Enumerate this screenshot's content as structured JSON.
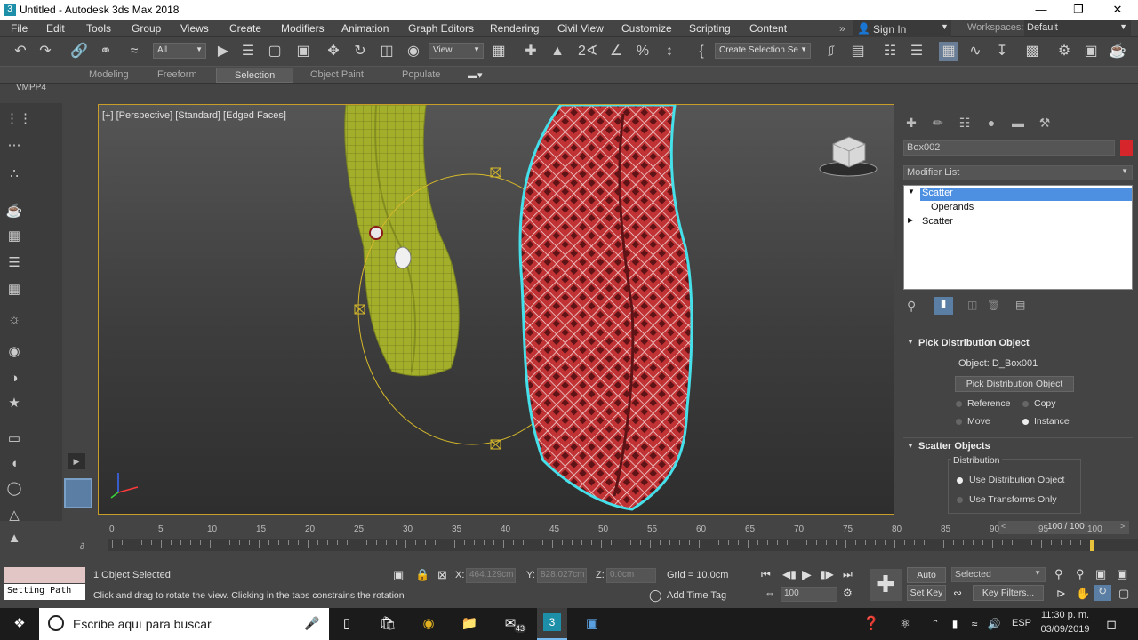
{
  "window": {
    "title": "Untitled - Autodesk 3ds Max 2018",
    "app_icon": "3"
  },
  "menu": [
    "File",
    "Edit",
    "Tools",
    "Group",
    "Views",
    "Create",
    "Modifiers",
    "Animation",
    "Graph Editors",
    "Rendering",
    "Civil View",
    "Customize",
    "Scripting",
    "Content"
  ],
  "signin": {
    "label": "Sign In",
    "workspaces_label": "Workspaces:",
    "workspace": "Default"
  },
  "toolbar": {
    "filter": "All",
    "view": "View",
    "selection_set": "Create Selection Se"
  },
  "ribbon": {
    "tabs": [
      "Modeling",
      "Freeform",
      "Selection",
      "Object Paint",
      "Populate"
    ],
    "active": "Selection"
  },
  "ribbon_sub": {
    "label": "VMPP4"
  },
  "viewport": {
    "label": "[+] [Perspective] [Standard] [Edged Faces]"
  },
  "cmd": {
    "object_name": "Box002",
    "modifier_list": "Modifier List",
    "stack": [
      "Scatter",
      "Operands",
      "Scatter"
    ],
    "pick": {
      "title": "Pick Distribution Object",
      "object_label": "Object: D_Box001",
      "button": "Pick Distribution Object",
      "opt_reference": "Reference",
      "opt_copy": "Copy",
      "opt_move": "Move",
      "opt_instance": "Instance"
    },
    "scatter": {
      "title": "Scatter Objects",
      "group": "Distribution",
      "opt_use_dist": "Use Distribution Object",
      "opt_use_trans": "Use Transforms Only"
    }
  },
  "timeline": {
    "frame_display": "100 / 100",
    "ticks": [
      "0",
      "5",
      "10",
      "15",
      "20",
      "25",
      "30",
      "35",
      "40",
      "45",
      "50",
      "55",
      "60",
      "65",
      "70",
      "75",
      "80",
      "85",
      "90",
      "95",
      "100"
    ]
  },
  "status": {
    "maxscript": "Setting Path",
    "selected": "1 Object Selected",
    "prompt": "Click and drag to rotate the view.  Clicking in the tabs constrains the rotation",
    "x_label": "X:",
    "x_val": "464.129cm",
    "y_label": "Y:",
    "y_val": "828.027cm",
    "z_label": "Z:",
    "z_val": "0.0cm",
    "grid": "Grid = 10.0cm",
    "add_time_tag": "Add Time Tag",
    "frame": "100",
    "auto_key": "Auto Key",
    "set_key": "Set Key",
    "selected_dd": "Selected",
    "key_filters": "Key Filters..."
  },
  "taskbar": {
    "search": "Escribe aquí para buscar",
    "lang": "ESP",
    "time": "11:30 p. m.",
    "date": "03/09/2019",
    "mail_badge": "43"
  }
}
